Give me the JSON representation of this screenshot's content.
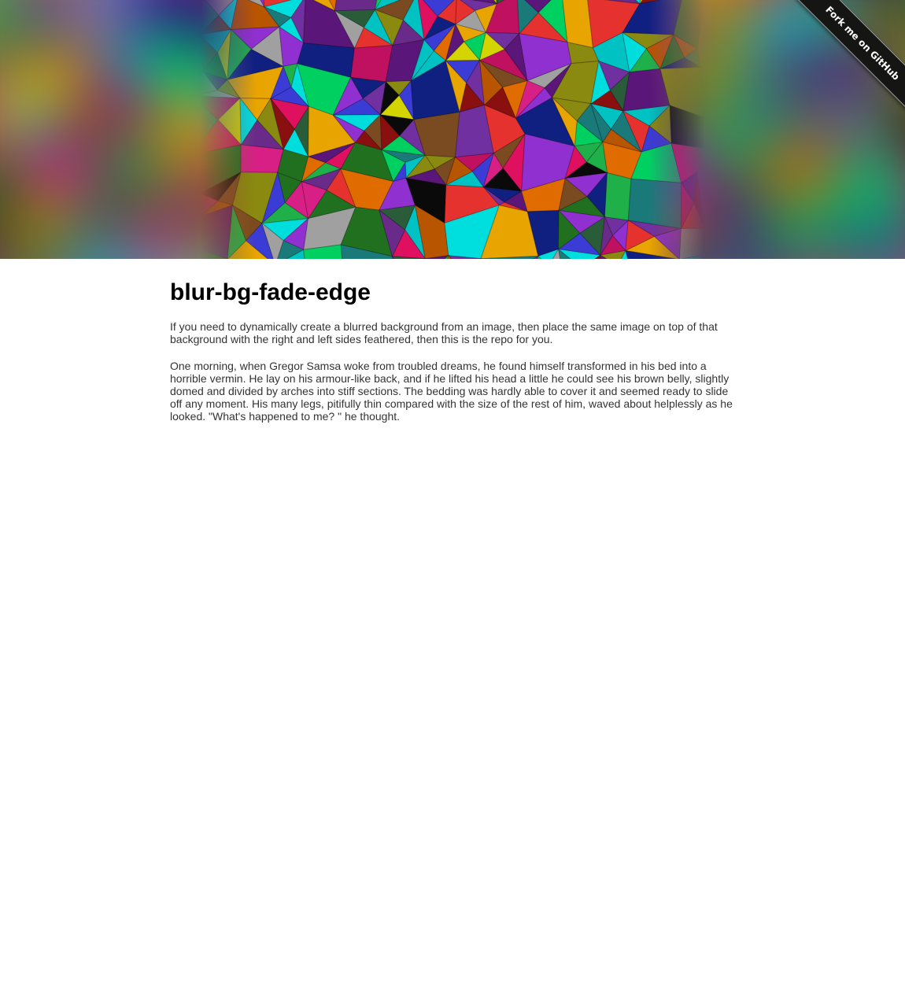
{
  "hero": {
    "ribbon_label": "Fork me on GitHub",
    "ribbon_color": "#151513"
  },
  "main": {
    "title": "blur-bg-fade-edge",
    "intro": "If you need to dynamically create a blurred background from an image, then place the same image on top of that background with the right and left sides feathered, then this is the repo for you.",
    "story": "One morning, when Gregor Samsa woke from troubled dreams, he found himself transformed in his bed into a horrible vermin. He lay on his armour-like back, and if he lifted his head a little he could see his brown belly, slightly domed and divided by arches into stiff sections. The bedding was hardly able to cover it and seemed ready to slide off any moment. His many legs, pitifully thin compared with the size of the rest of him, waved about helplessly as he looked. \"What's happened to me? \" he thought."
  },
  "colors": {
    "mosaic_palette": [
      "#e6322e",
      "#d81f86",
      "#5b167a",
      "#3b3bd6",
      "#7030a0",
      "#1fb04a",
      "#00c2c2",
      "#e8a400",
      "#d4d400",
      "#e06c00",
      "#8a1010",
      "#0a0a0a",
      "#00d060",
      "#2a5c3a",
      "#1a7a7a",
      "#c01060",
      "#8a8a10",
      "#b85500",
      "#6a2a8a",
      "#102080",
      "#00dddd",
      "#9030d0",
      "#e01060",
      "#207020",
      "#7a4a20",
      "#a0a0a0"
    ]
  }
}
